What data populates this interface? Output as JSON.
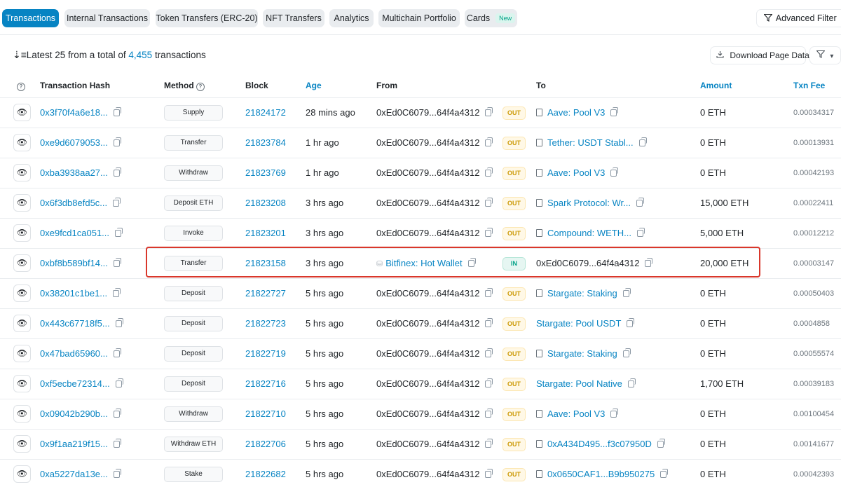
{
  "tabs": [
    {
      "label": "Transactions",
      "active": true
    },
    {
      "label": "Internal Transactions"
    },
    {
      "label": "Token Transfers (ERC-20)"
    },
    {
      "label": "NFT Transfers"
    },
    {
      "label": "Analytics"
    },
    {
      "label": "Multichain Portfolio"
    },
    {
      "label": "Cards",
      "badge": "New"
    }
  ],
  "advanced_filter": "Advanced Filter",
  "summary": {
    "prefix": "Latest 25 from a total of",
    "count": "4,455",
    "suffix": "transactions"
  },
  "download": "Download Page Data",
  "columns": {
    "hash": "Transaction Hash",
    "method": "Method",
    "block": "Block",
    "age": "Age",
    "from": "From",
    "to": "To",
    "amount": "Amount",
    "fee": "Txn Fee"
  },
  "rows": [
    {
      "hash": "0x3f70f4a6e18...",
      "method": "Supply",
      "block": "21824172",
      "age": "28 mins ago",
      "from": "0xEd0C6079...64f4a4312",
      "from_link": false,
      "dir": "OUT",
      "to": "Aave: Pool V3",
      "to_doc": true,
      "to_link": true,
      "amount": "0 ETH",
      "fee": "0.00034317"
    },
    {
      "hash": "0xe9d6079053...",
      "method": "Transfer",
      "block": "21823784",
      "age": "1 hr ago",
      "from": "0xEd0C6079...64f4a4312",
      "from_link": false,
      "dir": "OUT",
      "to": "Tether: USDT Stabl...",
      "to_doc": true,
      "to_link": true,
      "amount": "0 ETH",
      "fee": "0.00013931"
    },
    {
      "hash": "0xba3938aa27...",
      "method": "Withdraw",
      "block": "21823769",
      "age": "1 hr ago",
      "from": "0xEd0C6079...64f4a4312",
      "from_link": false,
      "dir": "OUT",
      "to": "Aave: Pool V3",
      "to_doc": true,
      "to_link": true,
      "amount": "0 ETH",
      "fee": "0.00042193"
    },
    {
      "hash": "0x6f3db8efd5c...",
      "method": "Deposit ETH",
      "block": "21823208",
      "age": "3 hrs ago",
      "from": "0xEd0C6079...64f4a4312",
      "from_link": false,
      "dir": "OUT",
      "to": "Spark Protocol: Wr...",
      "to_doc": true,
      "to_link": true,
      "amount": "15,000 ETH",
      "fee": "0.00022411"
    },
    {
      "hash": "0xe9fcd1ca051...",
      "method": "Invoke",
      "block": "21823201",
      "age": "3 hrs ago",
      "from": "0xEd0C6079...64f4a4312",
      "from_link": false,
      "dir": "OUT",
      "to": "Compound: WETH...",
      "to_doc": true,
      "to_link": true,
      "amount": "5,000 ETH",
      "fee": "0.00012212"
    },
    {
      "hash": "0xbf8b589bf14...",
      "method": "Transfer",
      "block": "21823158",
      "age": "3 hrs ago",
      "from": "Bitfinex: Hot Wallet",
      "from_link": true,
      "dir": "IN",
      "to": "0xEd0C6079...64f4a4312",
      "to_doc": false,
      "to_link": false,
      "amount": "20,000 ETH",
      "fee": "0.00003147"
    },
    {
      "hash": "0x38201c1be1...",
      "method": "Deposit",
      "block": "21822727",
      "age": "5 hrs ago",
      "from": "0xEd0C6079...64f4a4312",
      "from_link": false,
      "dir": "OUT",
      "to": "Stargate: Staking",
      "to_doc": true,
      "to_link": true,
      "amount": "0 ETH",
      "fee": "0.00050403"
    },
    {
      "hash": "0x443c67718f5...",
      "method": "Deposit",
      "block": "21822723",
      "age": "5 hrs ago",
      "from": "0xEd0C6079...64f4a4312",
      "from_link": false,
      "dir": "OUT",
      "to": "Stargate: Pool USDT",
      "to_doc": false,
      "to_link": true,
      "amount": "0 ETH",
      "fee": "0.0004858"
    },
    {
      "hash": "0x47bad65960...",
      "method": "Deposit",
      "block": "21822719",
      "age": "5 hrs ago",
      "from": "0xEd0C6079...64f4a4312",
      "from_link": false,
      "dir": "OUT",
      "to": "Stargate: Staking",
      "to_doc": true,
      "to_link": true,
      "amount": "0 ETH",
      "fee": "0.00055574"
    },
    {
      "hash": "0xf5ecbe72314...",
      "method": "Deposit",
      "block": "21822716",
      "age": "5 hrs ago",
      "from": "0xEd0C6079...64f4a4312",
      "from_link": false,
      "dir": "OUT",
      "to": "Stargate: Pool Native",
      "to_doc": false,
      "to_link": true,
      "amount": "1,700 ETH",
      "fee": "0.00039183"
    },
    {
      "hash": "0x09042b290b...",
      "method": "Withdraw",
      "block": "21822710",
      "age": "5 hrs ago",
      "from": "0xEd0C6079...64f4a4312",
      "from_link": false,
      "dir": "OUT",
      "to": "Aave: Pool V3",
      "to_doc": true,
      "to_link": true,
      "amount": "0 ETH",
      "fee": "0.00100454"
    },
    {
      "hash": "0x9f1aa219f15...",
      "method": "Withdraw ETH",
      "block": "21822706",
      "age": "5 hrs ago",
      "from": "0xEd0C6079...64f4a4312",
      "from_link": false,
      "dir": "OUT",
      "to": "0xA434D495...f3c07950D",
      "to_doc": true,
      "to_link": true,
      "amount": "0 ETH",
      "fee": "0.00141677"
    },
    {
      "hash": "0xa5227da13e...",
      "method": "Stake",
      "block": "21822682",
      "age": "5 hrs ago",
      "from": "0xEd0C6079...64f4a4312",
      "from_link": false,
      "dir": "OUT",
      "to": "0x0650CAF1...B9b950275",
      "to_doc": true,
      "to_link": true,
      "amount": "0 ETH",
      "fee": "0.00042393"
    }
  ],
  "highlighted_row": 5,
  "colors": {
    "accent": "#0784c3",
    "out": "#cc9a06",
    "in": "#00a186",
    "highlight": "#d9372b"
  }
}
